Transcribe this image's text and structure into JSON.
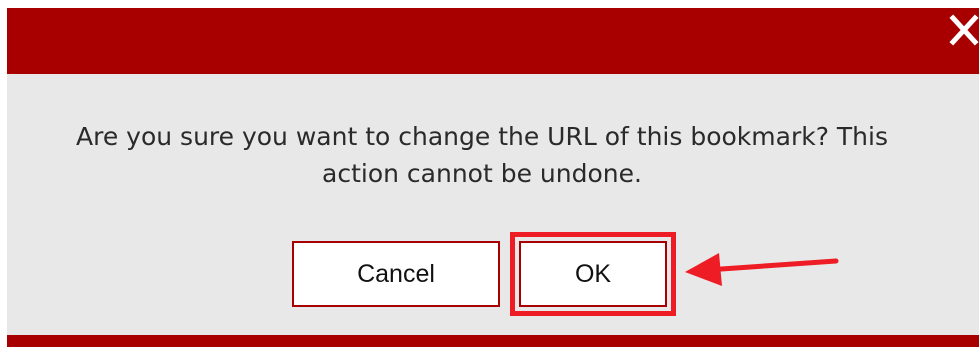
{
  "dialog": {
    "message_line1": "Are you sure you want to change the URL of this bookmark? This",
    "message_line2": "action cannot be undone.",
    "close_icon": "close-icon",
    "buttons": {
      "cancel_label": "Cancel",
      "ok_label": "OK"
    }
  },
  "annotation": {
    "arrow_icon": "arrow-left-icon",
    "highlight_color": "#ee1c25"
  },
  "colors": {
    "titlebar": "#a80000",
    "background": "#e8e8e8"
  }
}
